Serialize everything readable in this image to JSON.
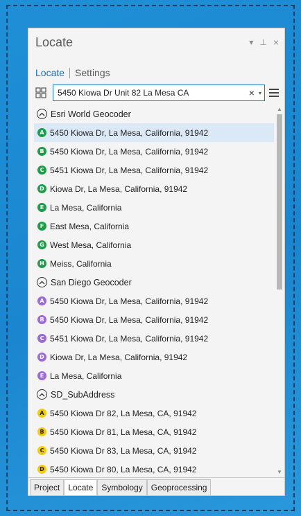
{
  "pane": {
    "title": "Locate",
    "dropdown_glyph": "▾",
    "pin_glyph": "⊥",
    "close_glyph": "×"
  },
  "subtabs": {
    "active": "Locate",
    "other": "Settings"
  },
  "search": {
    "value": "5450 Kiowa Dr Unit 82 La Mesa CA",
    "clear_glyph": "×",
    "dropdown_glyph": "▾"
  },
  "groups": [
    {
      "name": "Esri World Geocoder",
      "marker_color": "#1f9c4a",
      "marker_text": "#ffffff",
      "results": [
        {
          "letter": "A",
          "text": "5450 Kiowa Dr, La Mesa, California, 91942"
        },
        {
          "letter": "B",
          "text": "5450 Kiowa Dr, La Mesa, California, 91942"
        },
        {
          "letter": "C",
          "text": "5451 Kiowa Dr, La Mesa, California, 91942"
        },
        {
          "letter": "D",
          "text": "Kiowa Dr, La Mesa, California, 91942"
        },
        {
          "letter": "E",
          "text": "La Mesa, California"
        },
        {
          "letter": "F",
          "text": "East Mesa, California"
        },
        {
          "letter": "G",
          "text": "West Mesa, California"
        },
        {
          "letter": "H",
          "text": "Meiss, California"
        }
      ]
    },
    {
      "name": "San Diego Geocoder",
      "marker_color": "#9b6ad6",
      "marker_text": "#ffffff",
      "results": [
        {
          "letter": "A",
          "text": "5450 Kiowa Dr, La Mesa, California, 91942"
        },
        {
          "letter": "B",
          "text": "5450 Kiowa Dr, La Mesa, California, 91942"
        },
        {
          "letter": "C",
          "text": "5451 Kiowa Dr, La Mesa, California, 91942"
        },
        {
          "letter": "D",
          "text": "Kiowa Dr, La Mesa, California, 91942"
        },
        {
          "letter": "E",
          "text": "La Mesa, California"
        }
      ]
    },
    {
      "name": "SD_SubAddress",
      "marker_color": "#f2cc0c",
      "marker_text": "#222222",
      "results": [
        {
          "letter": "A",
          "text": "5450 Kiowa Dr 82, La Mesa, CA, 91942"
        },
        {
          "letter": "B",
          "text": "5450 Kiowa Dr 81, La Mesa, CA, 91942"
        },
        {
          "letter": "C",
          "text": "5450 Kiowa Dr 83, La Mesa, CA, 91942"
        },
        {
          "letter": "D",
          "text": "5450 Kiowa Dr 80, La Mesa, CA, 91942"
        }
      ]
    }
  ],
  "selected_result": "Esri World Geocoder/A",
  "bottom_tabs": [
    "Project",
    "Locate",
    "Symbology",
    "Geoprocessing"
  ],
  "active_bottom_tab": "Locate",
  "colors": {
    "accent": "#1c6fb8",
    "selection": "#dbe9f6",
    "background": "#1f8fd6"
  }
}
